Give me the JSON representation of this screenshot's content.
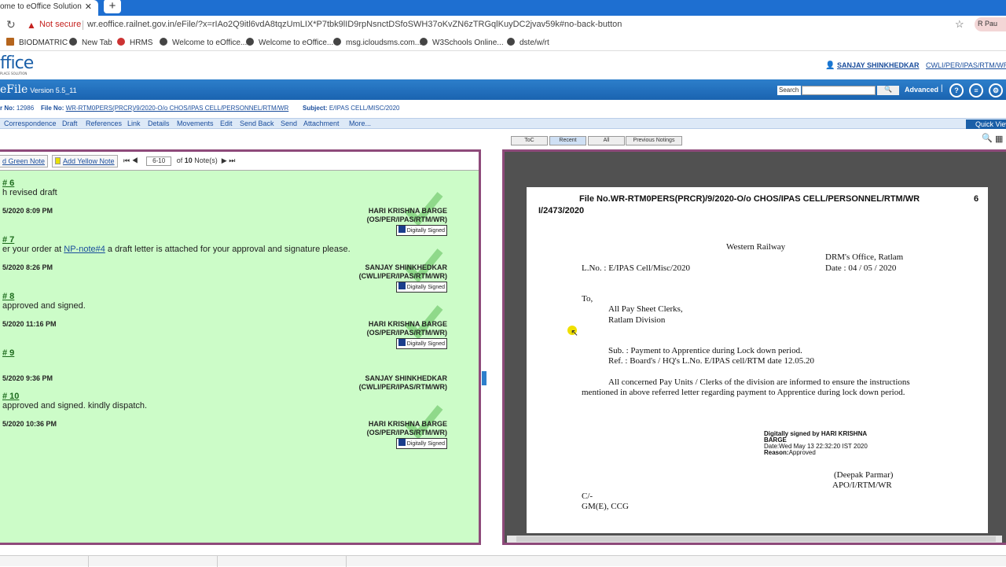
{
  "browser": {
    "tab_title": "ome to eOffice Solution",
    "not_secure": "Not secure",
    "url": "wr.eoffice.railnet.gov.in/eFile/?x=rIAo2Q9itl6vdA8tqzUmLIX*P7tbk9lID9rpNsnctDSfoSWH37oKvZN6zTRGqlKuyDC2jvav59k#no-back-button",
    "profile": "Pau",
    "bookmarks": [
      "BIODMATRIC",
      "New Tab",
      "HRMS",
      "Welcome to eOffice...",
      "Welcome to eOffice...",
      "msg.icloudsms.com...",
      "W3Schools Online...",
      "dste/w/rt"
    ]
  },
  "app": {
    "logo": "ffice",
    "logo_sub": "PLACE SOLUTION",
    "user_name": "SANJAY SHINKHEDKAR",
    "user_post": "CWLI/PER/IPAS/RTM/WR/S",
    "title": "eFile",
    "version": "Version 5.5_11",
    "search_label": "Search",
    "advanced": "Advanced",
    "pipe": "|",
    "file_info": {
      "receipt_label": "r No:",
      "receipt_no": "12986",
      "file_label": "File No:",
      "file_no": "WR-RTM0PERS(PRCR)/9/2020-O/o CHOS/IPAS CELL/PERSONNEL/RTM/WR",
      "subject_label": "Subject:",
      "subject": "E/IPAS CELL/MISC/2020"
    },
    "menu": [
      "Correspondence",
      "Draft",
      "References",
      "Link",
      "Details",
      "Movements",
      "Edit",
      "Send Back",
      "Send",
      "Attachment",
      "More..."
    ],
    "quick_view": "Quick View"
  },
  "notes": {
    "add_green": "d Green Note",
    "add_yellow": "Add Yellow Note",
    "page_range": "6-10",
    "of_label": "of",
    "total": "10",
    "notes_label": "Note(s)",
    "digitally_signed": "Digitally Signed",
    "items": [
      {
        "num": "# 6",
        "text": "h revised draft",
        "date": "5/2020 8:09 PM",
        "signer": "HARI KRISHNA BARGE",
        "post": "(OS/PER/IPAS/RTM/WR)"
      },
      {
        "num": "# 7",
        "text_pre": "er your order at ",
        "link": "NP-note#4",
        "text_post": " a draft letter is attached for your approval and signature please.",
        "date": "5/2020 8:26 PM",
        "signer": "SANJAY SHINKHEDKAR",
        "post": "(CWLI/PER/IPAS/RTM/WR)"
      },
      {
        "num": "# 8",
        "text": " approved and signed.",
        "date": "5/2020 11:16 PM",
        "signer": "HARI KRISHNA BARGE",
        "post": "(OS/PER/IPAS/RTM/WR)"
      },
      {
        "num": "# 9",
        "text": "",
        "date": "5/2020 9:36 PM",
        "signer": "SANJAY SHINKHEDKAR",
        "post": "(CWLI/PER/IPAS/RTM/WR)"
      },
      {
        "num": "# 10",
        "text": " approved and signed. kindly dispatch.",
        "date": "5/2020 10:36 PM",
        "signer": "HARI KRISHNA BARGE",
        "post": "(OS/PER/IPAS/RTM/WR)"
      }
    ]
  },
  "viewer": {
    "tabs": [
      "ToC",
      "Recent",
      "All",
      "Previous Notings"
    ],
    "selected_tab": "Recent"
  },
  "document": {
    "file_line1": "File No.WR-RTM0PERS(PRCR)/9/2020-O/o CHOS/IPAS CELL/PERSONNEL/RTM/WR",
    "page_no": "6",
    "file_line2": "I/2473/2020",
    "org": "Western Railway",
    "office": "DRM's Office, Ratlam",
    "lno": "L.No. : E/IPAS Cell/Misc/2020",
    "date": "Date :   04 / 05 / 2020",
    "to": "To,",
    "to1": "All Pay Sheet Clerks,",
    "to2": "Ratlam Division",
    "sub": "Sub. : Payment to Apprentice during Lock down period.",
    "ref": "Ref. :  Board's / HQ's L.No.  E/IPAS cell/RTM date 12.05.20",
    "body1": "All concerned Pay Units / Clerks of the division are informed to ensure the instructions",
    "body2": "mentioned in above referred letter regarding payment to Apprentice during lock down period.",
    "ds1": "Digitally signed by HARI KRISHNA",
    "ds2": "BARGE",
    "ds3": "Date:Wed May 13 22:32:20 IST 2020",
    "ds4_label": "Reason:",
    "ds4": "Approved",
    "sign_name": "(Deepak Parmar)",
    "sign_post": "APO/I/RTM/WR",
    "cc1": "C/-",
    "cc2": "GM(E), CCG"
  }
}
